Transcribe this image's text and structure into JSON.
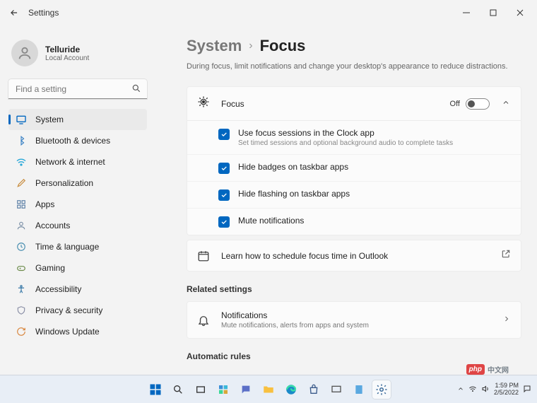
{
  "window": {
    "title": "Settings"
  },
  "user": {
    "name": "Telluride",
    "account_type": "Local Account"
  },
  "search": {
    "placeholder": "Find a setting"
  },
  "nav": [
    {
      "label": "System",
      "selected": true,
      "icon": "system"
    },
    {
      "label": "Bluetooth & devices",
      "icon": "bluetooth"
    },
    {
      "label": "Network & internet",
      "icon": "wifi"
    },
    {
      "label": "Personalization",
      "icon": "brush"
    },
    {
      "label": "Apps",
      "icon": "apps"
    },
    {
      "label": "Accounts",
      "icon": "person"
    },
    {
      "label": "Time & language",
      "icon": "clock"
    },
    {
      "label": "Gaming",
      "icon": "game"
    },
    {
      "label": "Accessibility",
      "icon": "access"
    },
    {
      "label": "Privacy & security",
      "icon": "shield"
    },
    {
      "label": "Windows Update",
      "icon": "update"
    }
  ],
  "breadcrumb": {
    "parent": "System",
    "current": "Focus"
  },
  "page_desc": "During focus, limit notifications and change your desktop's appearance to reduce distractions.",
  "focus_card": {
    "title": "Focus",
    "toggle_state": "Off",
    "options": [
      {
        "label": "Use focus sessions in the Clock app",
        "sub": "Set timed sessions and optional background audio to complete tasks",
        "checked": true
      },
      {
        "label": "Hide badges on taskbar apps",
        "checked": true
      },
      {
        "label": "Hide flashing on taskbar apps",
        "checked": true
      },
      {
        "label": "Mute notifications",
        "checked": true
      }
    ]
  },
  "outlook_card": {
    "label": "Learn how to schedule focus time in Outlook"
  },
  "related_heading": "Related settings",
  "notifications_card": {
    "title": "Notifications",
    "sub": "Mute notifications, alerts from apps and system"
  },
  "auto_rules_heading": "Automatic rules",
  "taskbar": {
    "time": "1:59 PM",
    "date": "2/5/2022"
  },
  "watermark": {
    "logo": "php",
    "text": "中文网"
  }
}
